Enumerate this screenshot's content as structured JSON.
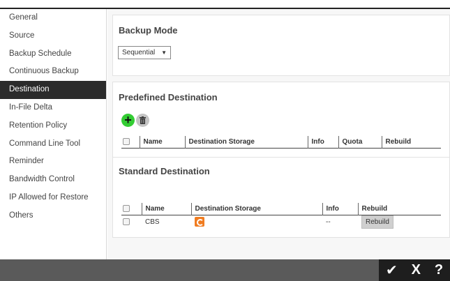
{
  "sidebar": {
    "items": [
      {
        "label": "General"
      },
      {
        "label": "Source"
      },
      {
        "label": "Backup Schedule"
      },
      {
        "label": "Continuous Backup"
      },
      {
        "label": "Destination",
        "active": true
      },
      {
        "label": "In-File Delta"
      },
      {
        "label": "Retention Policy"
      },
      {
        "label": "Command Line Tool"
      },
      {
        "label": "Reminder"
      },
      {
        "label": "Bandwidth Control"
      },
      {
        "label": "IP Allowed for Restore"
      },
      {
        "label": "Others"
      }
    ]
  },
  "backup_mode": {
    "title": "Backup Mode",
    "selected": "Sequential",
    "arrow": "▼"
  },
  "predefined": {
    "title": "Predefined Destination",
    "columns": [
      "Name",
      "Destination Storage",
      "Info",
      "Quota",
      "Rebuild"
    ],
    "icons": {
      "add": "+",
      "delete": "trash-icon"
    }
  },
  "standard": {
    "title": "Standard Destination",
    "columns": [
      "Name",
      "Destination Storage",
      "Info",
      "Rebuild"
    ],
    "rows": [
      {
        "name": "CBS",
        "storage_icon": "cbs-storage-icon",
        "info": "--",
        "rebuild": "Rebuild"
      }
    ]
  },
  "footer": {
    "ok": "✔",
    "cancel": "X",
    "help": "?"
  },
  "colors": {
    "active_nav": "#2b2b2b",
    "add_icon": "#33cc33",
    "storage_icon": "#f07c21",
    "footer": "#5a5a5a"
  }
}
